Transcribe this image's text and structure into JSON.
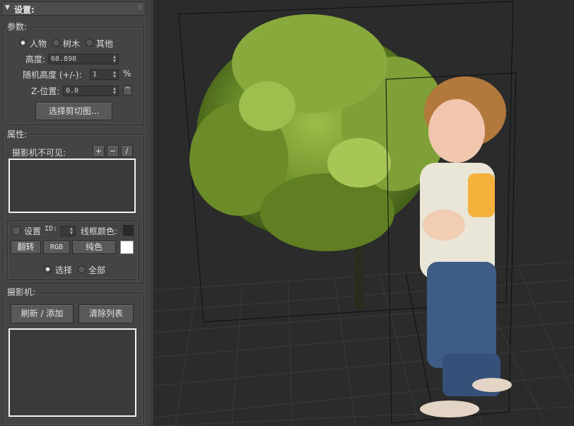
{
  "rollout": {
    "title": "设置:"
  },
  "params": {
    "label": "参数:",
    "radio_options": [
      "人物",
      "树木",
      "其他"
    ],
    "height_label": "高度:",
    "height_value": "68.898",
    "random_height_label": "随机高度 (+/-):",
    "random_height_value": "1",
    "percent_symbol": "%",
    "z_pos_label": "Z-位置:",
    "z_pos_value": "0.0",
    "select_clip_button": "选择剪切图..."
  },
  "attributes": {
    "label": "属性:",
    "camera_invisible_label": "摄影机不可见:",
    "add_btn": "+",
    "remove_btn": "−",
    "edit_btn": "/",
    "set_label": "设置",
    "id_label": "ID:",
    "wire_color_label": "线框颜色:",
    "wire_color": "#2a2a2a",
    "flip_btn": "翻转",
    "rgb_btn": "RGB",
    "solid_btn": "纯色",
    "solid_color": "#ffffff",
    "select_option": "选择",
    "all_option": "全部"
  },
  "camera": {
    "label": "摄影机:",
    "refresh_btn": "刷新 / 添加",
    "clear_btn": "清除列表"
  }
}
